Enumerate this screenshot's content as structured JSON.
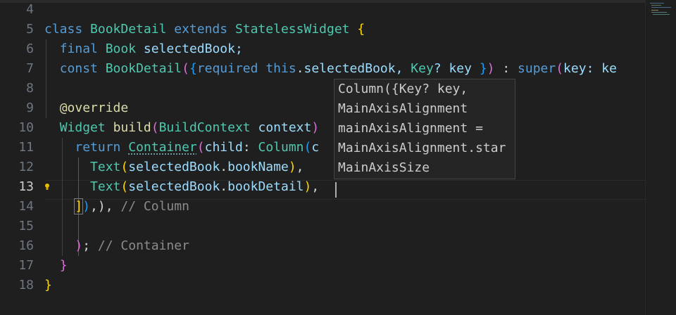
{
  "gutter": [
    "4",
    "5",
    "6",
    "7",
    "8",
    "9",
    "10",
    "11",
    "12",
    "13",
    "14",
    "15",
    "16",
    "17",
    "18"
  ],
  "active_line_number": "13",
  "code": {
    "l5": {
      "kw1": "class",
      "name": "BookDetail",
      "kw2": "extends",
      "base": "StatelessWidget",
      "brace": "{"
    },
    "l6": {
      "kw": "final",
      "type": "Book",
      "field": "selectedBook;"
    },
    "l7": {
      "kw": "const",
      "name": "BookDetail",
      "p1": "(",
      "b1": "{",
      "req": "required",
      "this": "this",
      "dot": ".",
      "field": "selectedBook,",
      "type": "Key",
      "rest": "? key ",
      "b2": "}",
      "p2": ")",
      "colon": " : ",
      "sup": "super",
      "p3": "(",
      "arg": "key",
      "tail": ": ke"
    },
    "l9": {
      "ann": "@override"
    },
    "l10": {
      "type": "Widget",
      "fn": "build",
      "p1": "(",
      "ctx": "BuildContext",
      "param": "context",
      "p2": ")"
    },
    "l11": {
      "kw": "return",
      "cls1": "Container",
      "p1": "(",
      "arg": "child",
      "colon": ": ",
      "cls2": "Column",
      "p2": "(",
      "tail": "c"
    },
    "l12": {
      "cls": "Text",
      "p1": "(",
      "obj": "selectedBook",
      "dot": ".",
      "prop": "bookName",
      "p2": ")",
      "comma": ","
    },
    "l13": {
      "cls": "Text",
      "p1": "(",
      "obj": "selectedBook",
      "dot": ".",
      "prop": "bookDetail",
      "p2": ")",
      "comma": ","
    },
    "l14": {
      "b": "]",
      "p": ")",
      "punct": ",), ",
      "comment": "// Column"
    },
    "l16": {
      "p": ")",
      "punct": "; ",
      "comment": "// Container"
    },
    "l17": {
      "b": "}"
    },
    "l18": {
      "b": "}"
    }
  },
  "hover": [
    "Column({Key? key,",
    "MainAxisAlignment",
    "mainAxisAlignment =",
    "MainAxisAlignment.star",
    "MainAxisSize"
  ],
  "colors": {
    "background": "#1f1f1f",
    "keyword": "#569cd6",
    "class": "#4ec9b0",
    "function": "#dcdcaa",
    "variable": "#9cdcfe",
    "comment": "#8b8b8b",
    "bracket_gold": "#ffd700",
    "bracket_purple": "#da70d6",
    "bracket_blue": "#179fff"
  },
  "icons": {
    "lightbulb": "lightbulb-icon"
  }
}
